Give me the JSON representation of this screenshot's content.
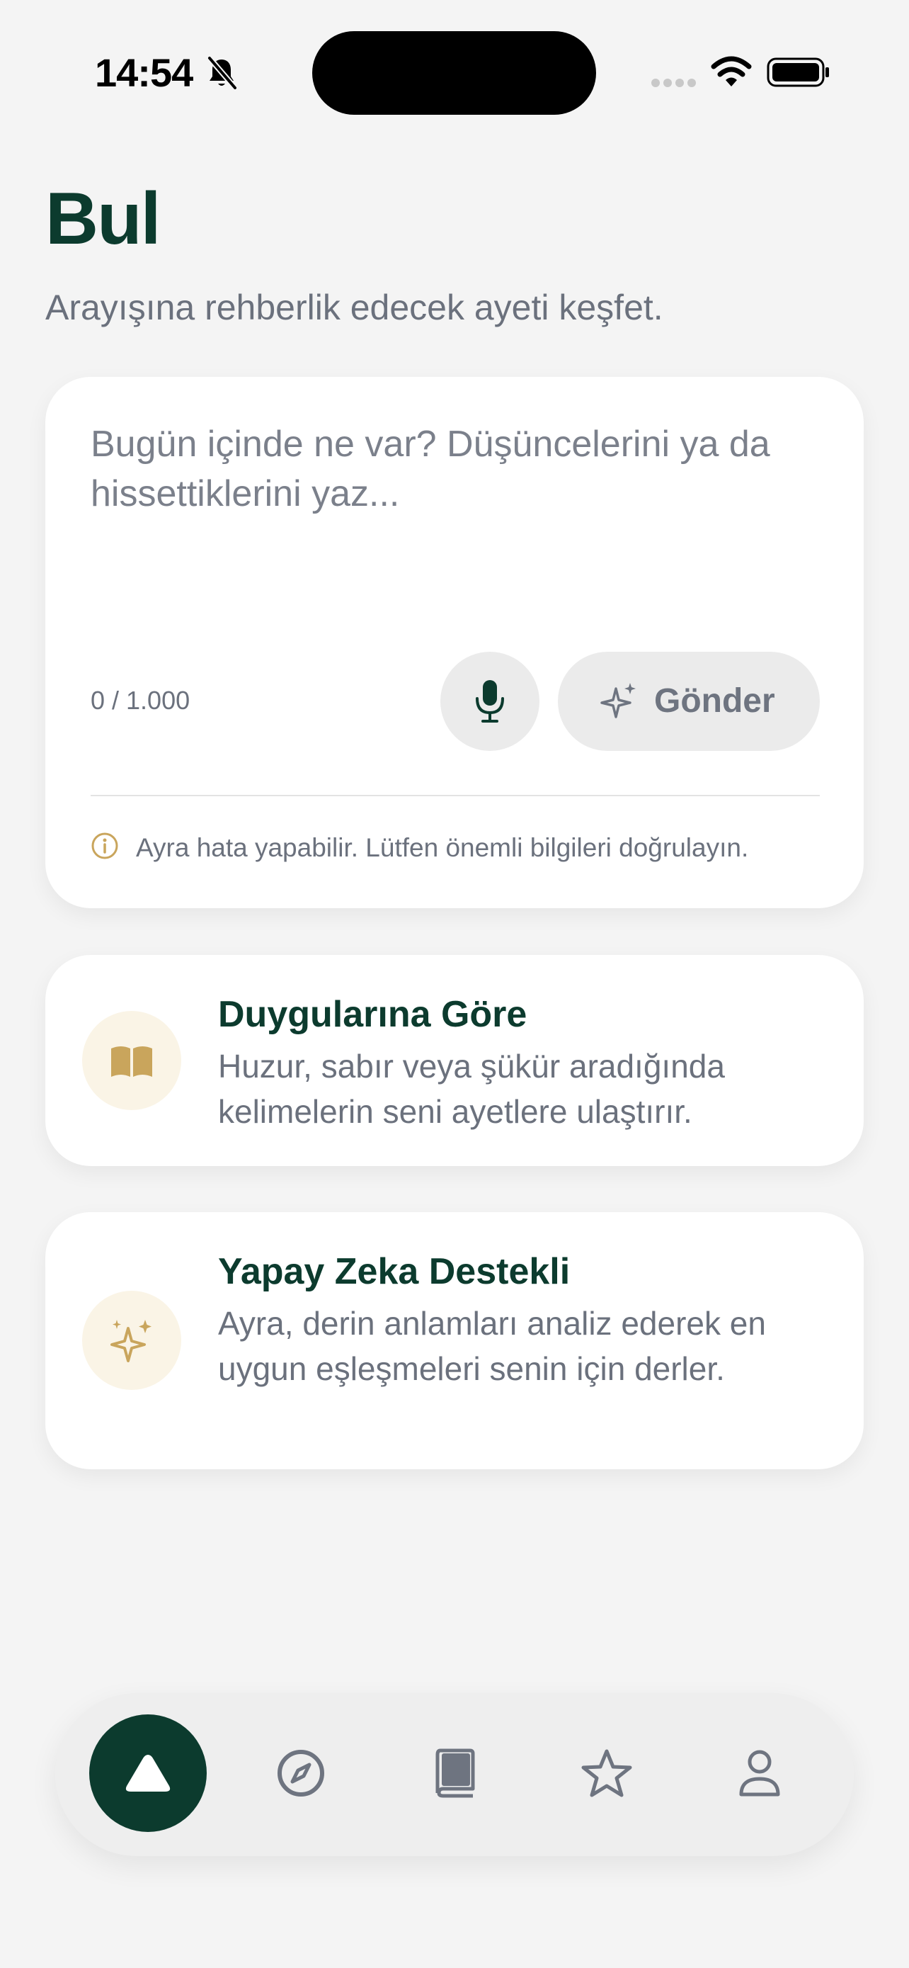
{
  "status_bar": {
    "time": "14:54",
    "silent_icon": "bell-slash-icon",
    "cellular_icon": "cellular-dots-icon",
    "wifi_icon": "wifi-icon",
    "battery_icon": "battery-full-icon"
  },
  "header": {
    "title": "Bul",
    "subtitle": "Arayışına rehberlik edecek ayeti keşfet."
  },
  "input_card": {
    "placeholder": "Bugün içinde ne var? Düşüncelerini ya da hissettiklerini yaz...",
    "value": "",
    "counter": "0 / 1.000",
    "mic_icon": "microphone-icon",
    "send_icon": "sparkles-icon",
    "send_label": "Gönder",
    "info_icon": "info-circle-icon",
    "disclaimer": "Ayra hata yapabilir. Lütfen önemli bilgileri doğrulayın."
  },
  "features": [
    {
      "icon": "open-book-icon",
      "title": "Duygularına Göre",
      "description": "Huzur, sabır veya şükür aradığında kelimelerin seni ayetlere ulaştırır."
    },
    {
      "icon": "sparkles-icon",
      "title": "Yapay Zeka Destekli",
      "description": "Ayra, derin anlamları analiz ederek en uygun eşleşmeleri senin için derler."
    }
  ],
  "tab_bar": {
    "tabs": [
      {
        "icon": "triangle-home-icon",
        "active": true
      },
      {
        "icon": "compass-icon",
        "active": false
      },
      {
        "icon": "book-icon",
        "active": false
      },
      {
        "icon": "star-icon",
        "active": false
      },
      {
        "icon": "person-icon",
        "active": false
      }
    ]
  },
  "colors": {
    "background": "#f4f4f4",
    "primary_green": "#0c3b2e",
    "accent_gold": "#c9a55c",
    "muted_text": "#6b717d",
    "button_gray": "#ebebeb"
  }
}
